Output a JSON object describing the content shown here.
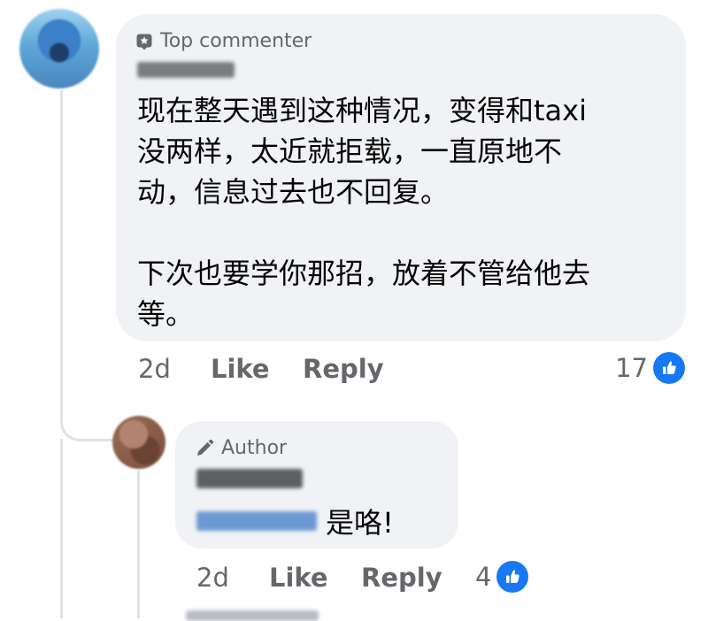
{
  "top_comment": {
    "badge_label": "Top commenter",
    "badge_icon": "star-badge-icon",
    "text": "现在整天遇到这种情况，变得和taxi\n没两样，太近就拒载，一直原地不\n动，信息过去也不回复。\n\n下次也要学你那招，放着不管给他去\n等。",
    "time": "2d",
    "like_label": "Like",
    "reply_label": "Reply",
    "reaction_count": "17",
    "reaction_icon": "thumbs-up-icon"
  },
  "author_reply": {
    "badge_label": "Author",
    "badge_icon": "pencil-icon",
    "text": "是咯!",
    "time": "2d",
    "like_label": "Like",
    "reply_label": "Reply",
    "reaction_count": "4",
    "reaction_icon": "thumbs-up-icon"
  },
  "colors": {
    "bubble": "#f0f2f5",
    "secondary_text": "#65676b",
    "like_blue": "#1877f2"
  }
}
